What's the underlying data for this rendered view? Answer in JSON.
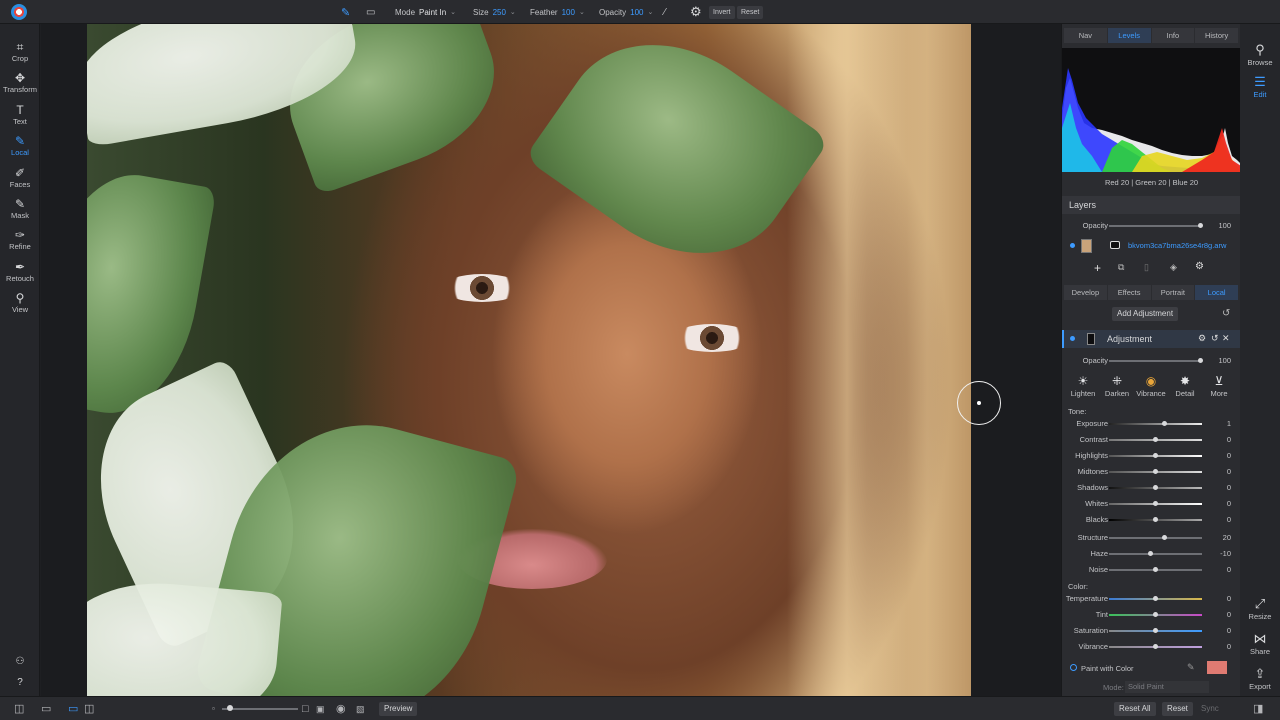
{
  "toolbar": {
    "mode_label": "Mode",
    "mode_value": "Paint In",
    "size_label": "Size",
    "size_value": "250",
    "feather_label": "Feather",
    "feather_value": "100",
    "opacity_label": "Opacity",
    "opacity_value": "100",
    "invert_label": "Invert",
    "reset_label": "Reset"
  },
  "left_tools": [
    {
      "label": "Crop",
      "icon": "crop-icon"
    },
    {
      "label": "Transform",
      "icon": "transform-icon"
    },
    {
      "label": "Text",
      "icon": "text-icon"
    },
    {
      "label": "Local",
      "icon": "local-brush-icon",
      "active": true
    },
    {
      "label": "Faces",
      "icon": "faces-icon"
    },
    {
      "label": "Mask",
      "icon": "mask-icon"
    },
    {
      "label": "Refine",
      "icon": "refine-icon"
    },
    {
      "label": "Retouch",
      "icon": "retouch-icon"
    },
    {
      "label": "View",
      "icon": "view-icon"
    }
  ],
  "panel": {
    "tabs": [
      "Nav",
      "Levels",
      "Info",
      "History"
    ],
    "active_tab": "Levels",
    "rgb_readout": "Red  20  | Green  20  | Blue  20",
    "layers": {
      "title": "Layers",
      "opacity_label": "Opacity",
      "opacity_value": "100",
      "layer_name": "bkvom3ca7bma26se4r8g.arw"
    },
    "module_tabs": [
      "Develop",
      "Effects",
      "Portrait",
      "Local"
    ],
    "active_module": "Local",
    "add_adjustment": "Add Adjustment",
    "adjustment": {
      "title": "Adjustment",
      "opacity_label": "Opacity",
      "opacity_value": "100",
      "presets": [
        "Lighten",
        "Darken",
        "Vibrance",
        "Detail",
        "More"
      ],
      "tone_label": "Tone:",
      "tone": [
        {
          "label": "Exposure",
          "value": "1",
          "pos": 0.6
        },
        {
          "label": "Contrast",
          "value": "0",
          "pos": 0.5
        },
        {
          "label": "Highlights",
          "value": "0",
          "pos": 0.5
        },
        {
          "label": "Midtones",
          "value": "0",
          "pos": 0.5
        },
        {
          "label": "Shadows",
          "value": "0",
          "pos": 0.5
        },
        {
          "label": "Whites",
          "value": "0",
          "pos": 0.5
        },
        {
          "label": "Blacks",
          "value": "0",
          "pos": 0.5
        }
      ],
      "detail": [
        {
          "label": "Structure",
          "value": "20",
          "pos": 0.6
        },
        {
          "label": "Haze",
          "value": "-10",
          "pos": 0.45
        },
        {
          "label": "Noise",
          "value": "0",
          "pos": 0.5
        }
      ],
      "color_label": "Color:",
      "color": [
        {
          "label": "Temperature",
          "value": "0",
          "pos": 0.5
        },
        {
          "label": "Tint",
          "value": "0",
          "pos": 0.5
        },
        {
          "label": "Saturation",
          "value": "0",
          "pos": 0.5
        },
        {
          "label": "Vibrance",
          "value": "0",
          "pos": 0.5
        }
      ],
      "paint_with_color": "Paint with Color",
      "paint_color": "#e07b72",
      "mode_label": "Mode:",
      "mode_value": "Solid Paint"
    }
  },
  "right_rail": [
    {
      "label": "Browse",
      "icon": "browse-icon"
    },
    {
      "label": "Edit",
      "icon": "edit-sliders-icon",
      "active": true
    },
    {
      "label": "Resize",
      "icon": "resize-icon"
    },
    {
      "label": "Share",
      "icon": "share-icon"
    },
    {
      "label": "Export",
      "icon": "export-icon"
    }
  ],
  "bottom": {
    "preview_label": "Preview",
    "reset_all_label": "Reset All",
    "reset_label": "Reset",
    "sync_label": "Sync"
  },
  "accent_color": "#3d9bff"
}
